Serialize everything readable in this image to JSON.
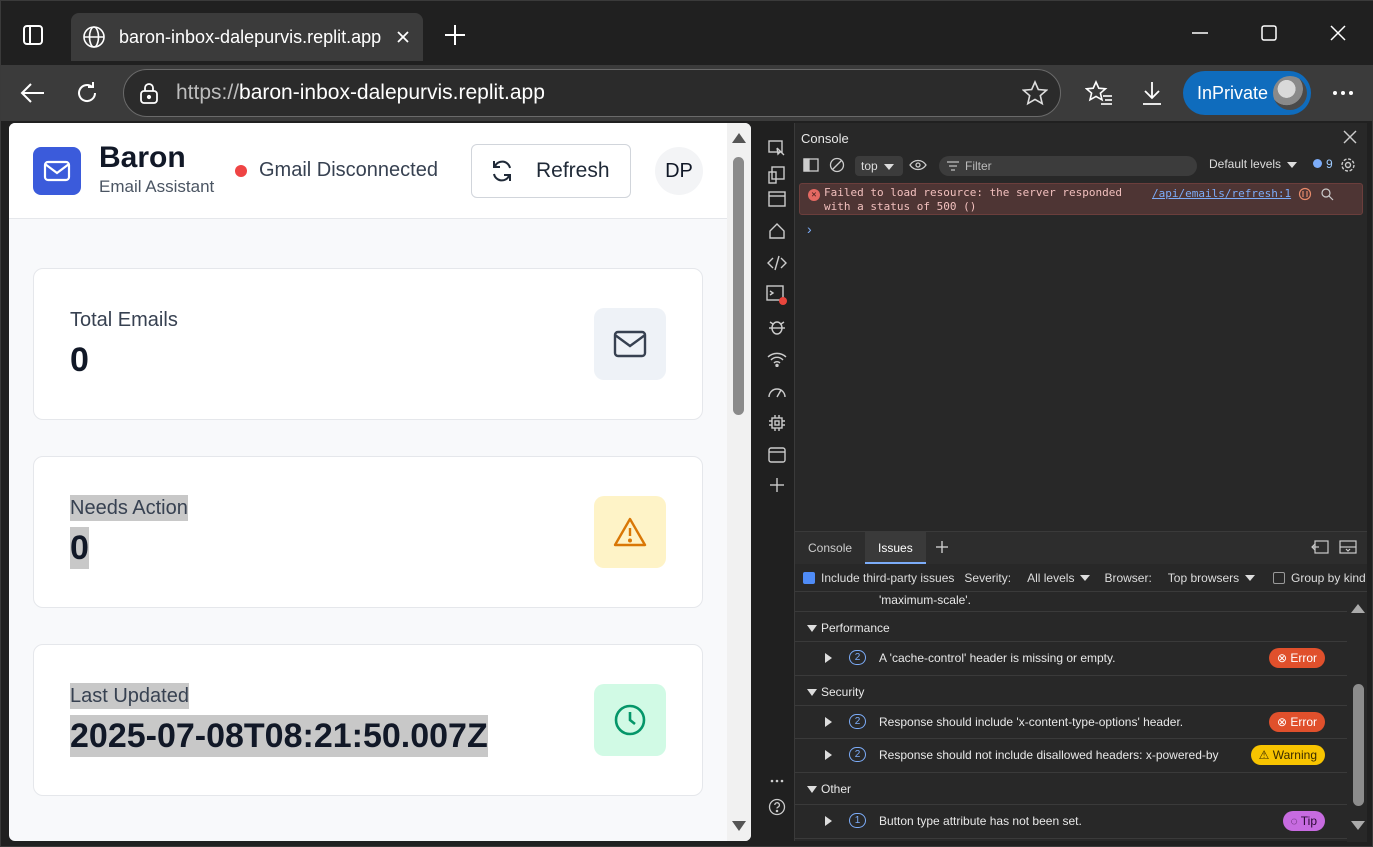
{
  "browser": {
    "tab_title": "baron-inbox-dalepurvis.replit.app",
    "url_scheme": "https://",
    "url_host": "baron-inbox-dalepurvis.replit.app",
    "inprivate_label": "InPrivate",
    "accent": "#0f6cbd"
  },
  "app": {
    "brand_name": "Baron",
    "brand_subtitle": "Email Assistant",
    "gmail_status": "Gmail Disconnected",
    "refresh_label": "Refresh",
    "user_initials": "DP",
    "accent": "#3b5bdb",
    "status_color": "#ef4444"
  },
  "stats": [
    {
      "label": "Total Emails",
      "value": "0",
      "icon": "mail-icon",
      "icon_bg": "#eef2f7",
      "icon_color": "#374151"
    },
    {
      "label": "Needs Action",
      "value": "0",
      "icon": "warning-icon",
      "icon_bg": "#fef3c7",
      "icon_color": "#d97706"
    },
    {
      "label": "Last Updated",
      "value": "2025-07-08T08:21:50.007Z",
      "icon": "clock-icon",
      "icon_bg": "#d1fae5",
      "icon_color": "#059669"
    }
  ],
  "devtools": {
    "panel_title": "Console",
    "context": "top",
    "filter_placeholder": "Filter",
    "levels": "Default levels",
    "message_count": "9",
    "error_text": "Failed to load resource: the server responded with a status of 500 ()",
    "error_source": "/api/emails/refresh:1",
    "drawer_tabs": [
      "Console",
      "Issues"
    ],
    "include_third_party": "Include third-party issues",
    "severity_label": "Severity:",
    "severity_value": "All levels",
    "browser_label": "Browser:",
    "browser_value": "Top browsers",
    "group_by_kind": "Group by kind",
    "truncated_text": "'maximum-scale'.",
    "sections": {
      "performance": "Performance",
      "security": "Security",
      "other": "Other"
    },
    "issues": [
      {
        "count": "2",
        "text": "A 'cache-control' header is missing or empty.",
        "severity": "Error"
      },
      {
        "count": "2",
        "text": "Response should include 'x-content-type-options' header.",
        "severity": "Error"
      },
      {
        "count": "2",
        "text": "Response should not include disallowed headers: x-powered-by",
        "severity": "Warning"
      },
      {
        "count": "1",
        "text": "Button type attribute has not been set.",
        "severity": "Tip"
      }
    ]
  }
}
